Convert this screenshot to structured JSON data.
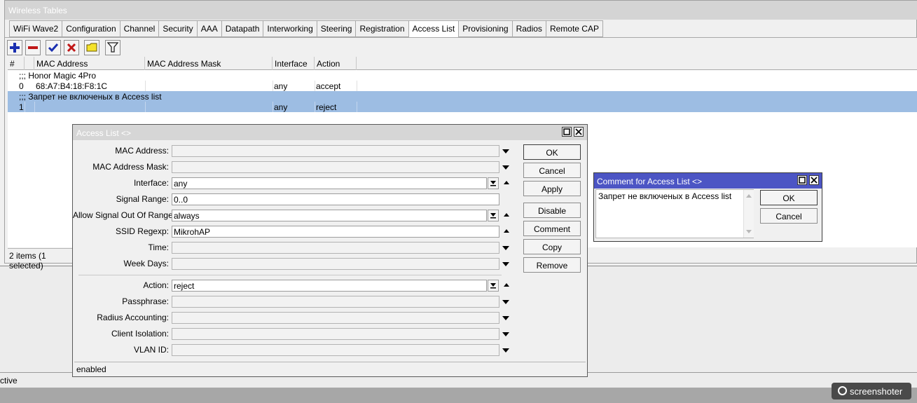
{
  "wireless_tables": {
    "title": "Wireless Tables",
    "tabs": [
      {
        "label": "WiFi Wave2"
      },
      {
        "label": "Configuration"
      },
      {
        "label": "Channel"
      },
      {
        "label": "Security"
      },
      {
        "label": "AAA"
      },
      {
        "label": "Datapath"
      },
      {
        "label": "Interworking"
      },
      {
        "label": "Steering"
      },
      {
        "label": "Registration"
      },
      {
        "label": "Access List",
        "active": true
      },
      {
        "label": "Provisioning"
      },
      {
        "label": "Radios"
      },
      {
        "label": "Remote CAP"
      }
    ],
    "toolbar": {
      "add_icon": "plus-icon",
      "remove_icon": "minus-icon",
      "enable_icon": "checkmark-icon",
      "disable_icon": "cross-icon",
      "comment_icon": "note-icon",
      "filter_icon": "filter-icon"
    },
    "table": {
      "columns": [
        "#",
        "MAC Address",
        "MAC Address Mask",
        "Interface",
        "Action"
      ],
      "comment_row_1": ";;; Honor Magic 4Pro",
      "row_1": {
        "num": "0",
        "mac": "68:A7:B4:18:F8:1C",
        "mask": "",
        "interface": "any",
        "action": "accept"
      },
      "comment_row_2": ";;; Запрет не включеных в Access list",
      "row_2": {
        "num": "1",
        "mac": "",
        "mask": "",
        "interface": "any",
        "action": "reject"
      }
    },
    "status": "2 items (1 selected)"
  },
  "access_list_dialog": {
    "title": "Access List <>",
    "fields": {
      "mac_address": {
        "label": "MAC Address:",
        "value": ""
      },
      "mac_mask": {
        "label": "MAC Address Mask:",
        "value": ""
      },
      "interface": {
        "label": "Interface:",
        "value": "any"
      },
      "signal_range": {
        "label": "Signal Range:",
        "value": "0..0"
      },
      "allow_signal": {
        "label": "Allow Signal Out Of Range:",
        "value": "always"
      },
      "ssid_regexp": {
        "label": "SSID Regexp:",
        "value": "MikrohAP"
      },
      "time": {
        "label": "Time:",
        "value": ""
      },
      "week_days": {
        "label": "Week Days:",
        "value": ""
      },
      "action": {
        "label": "Action:",
        "value": "reject"
      },
      "passphrase": {
        "label": "Passphrase:",
        "value": ""
      },
      "radius_accounting": {
        "label": "Radius Accounting:",
        "value": ""
      },
      "client_isolation": {
        "label": "Client Isolation:",
        "value": ""
      },
      "vlan_id": {
        "label": "VLAN ID:",
        "value": ""
      }
    },
    "buttons": {
      "ok": "OK",
      "cancel": "Cancel",
      "apply": "Apply",
      "disable": "Disable",
      "comment": "Comment",
      "copy": "Copy",
      "remove": "Remove"
    },
    "status": "enabled"
  },
  "comment_dialog": {
    "title": "Comment for Access List <>",
    "text": "Запрет не включеных в Access list",
    "buttons": {
      "ok": "OK",
      "cancel": "Cancel"
    }
  },
  "background": {
    "status_text": "ctive"
  },
  "watermark": {
    "text": "screenshoter"
  }
}
